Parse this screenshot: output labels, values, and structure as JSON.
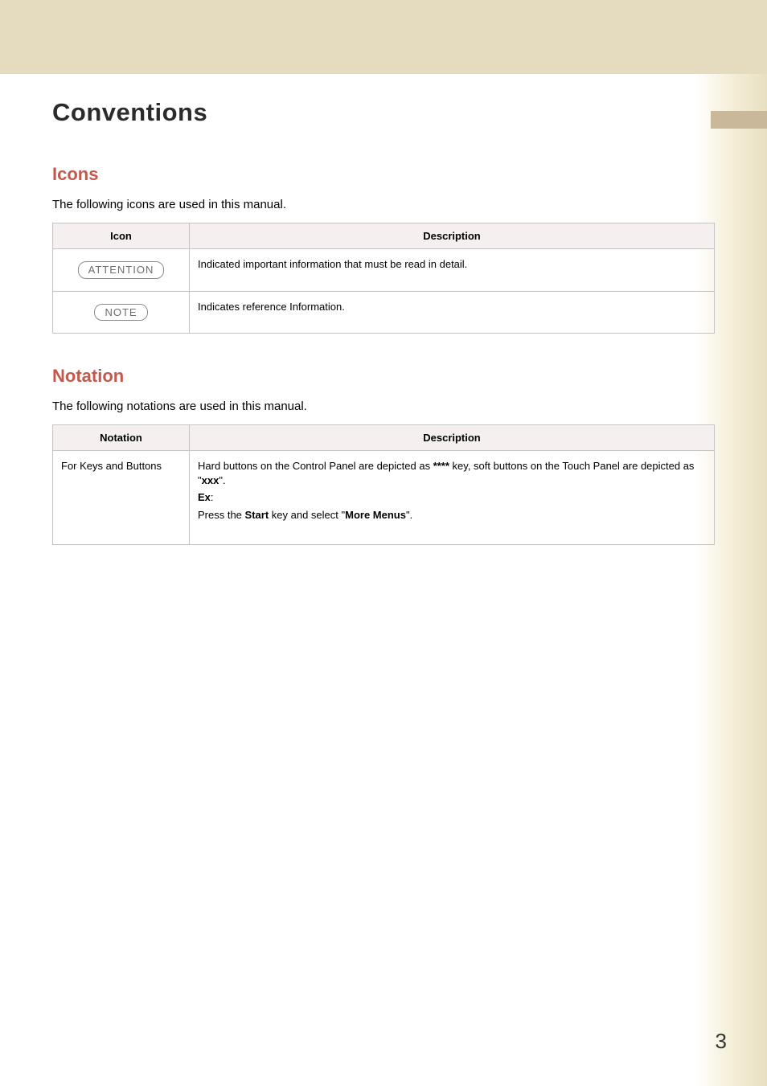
{
  "page_title": "Conventions",
  "page_number": "3",
  "sections": {
    "icons": {
      "heading": "Icons",
      "intro": "The following icons are used in this manual.",
      "table": {
        "headers": {
          "icon": "Icon",
          "description": "Description"
        },
        "rows": [
          {
            "icon_label": "ATTENTION",
            "description": "Indicated important information that must be read in detail."
          },
          {
            "icon_label": "NOTE",
            "description": "Indicates reference Information."
          }
        ]
      }
    },
    "notation": {
      "heading": "Notation",
      "intro": "The following notations are used in this manual.",
      "table": {
        "headers": {
          "notation": "Notation",
          "description": "Description"
        },
        "rows": [
          {
            "notation": "For Keys and Buttons",
            "desc_pre": "Hard buttons on the Control Panel are depicted as ",
            "desc_bold1": "****",
            "desc_mid1": " key, soft buttons on the Touch Panel are depicted as \"",
            "desc_bold2": "xxx",
            "desc_post1": "\".",
            "ex_label": "Ex",
            "ex_colon": ":",
            "line2_pre": "Press the ",
            "line2_bold1": "Start",
            "line2_mid": " key and select \"",
            "line2_bold2": "More Menus",
            "line2_post": "\"."
          }
        ]
      }
    }
  }
}
